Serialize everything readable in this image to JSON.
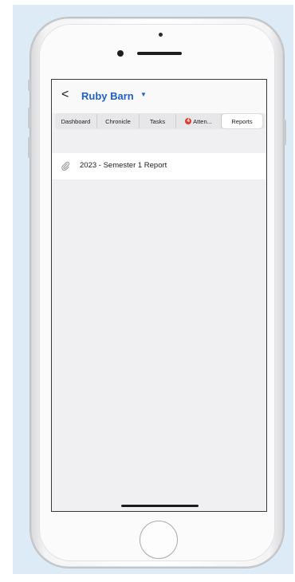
{
  "navbar": {
    "back_glyph": "<",
    "title": "Ruby Barn",
    "title_caret": "▼"
  },
  "tabs": [
    {
      "label": "Dashboard",
      "selected": false
    },
    {
      "label": "Chronicle",
      "selected": false
    },
    {
      "label": "Tasks",
      "selected": false
    },
    {
      "label": "Atten...",
      "badge": "4",
      "selected": false
    },
    {
      "label": "Reports",
      "selected": true
    }
  ],
  "reports": [
    {
      "label": "2023 - Semester 1 Report",
      "icon": "paperclip-icon"
    }
  ],
  "colors": {
    "accent": "#2060c8",
    "badge": "#d8402f",
    "screen_bg": "#f0f0f2",
    "page_bg": "#dcebf6"
  }
}
